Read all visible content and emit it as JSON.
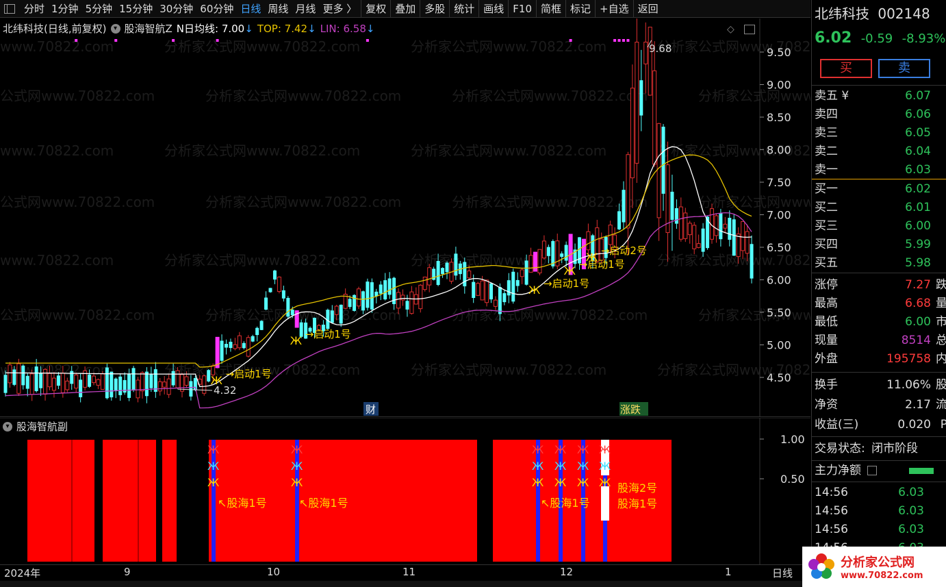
{
  "toolbar": {
    "items": [
      "分时",
      "1分钟",
      "5分钟",
      "15分钟",
      "30分钟",
      "60分钟",
      "日线",
      "周线",
      "月线",
      "更多 〉",
      "复权",
      "叠加",
      "多股",
      "统计",
      "画线",
      "F10",
      "简框",
      "标记",
      "+自选",
      "返回"
    ],
    "active": "日线"
  },
  "main_chart": {
    "stock_name": "北纬科技",
    "period_label": "(日线,前复权)",
    "indicator_name": "股海智航Z",
    "n_ma_label": "N日均线: 7.00",
    "top_label": "TOP: 7.42",
    "lin_label": "LIN: 6.58",
    "high_marker": "9.68",
    "low_marker": "4.32",
    "signal_labels": [
      "→启动1号",
      "→启动1号",
      "→启动1号",
      "→启动1号",
      "→启动2号"
    ],
    "badges": {
      "cai": "财",
      "zhangdie": "涨跌"
    },
    "price_axis": [
      "9.50",
      "9.00",
      "8.50",
      "8.00",
      "7.50",
      "7.00",
      "6.50",
      "6.00",
      "5.50",
      "5.00",
      "4.50"
    ],
    "watermark": "分析家公式网www.70822.com"
  },
  "sub_chart": {
    "title": "股海智航副",
    "axis": [
      "1.00",
      "0.50"
    ],
    "labels": [
      "↖股海1号",
      "↖股海1号",
      "↖股海1号",
      "股海2号",
      "股海1号"
    ]
  },
  "date_axis": [
    "2024年",
    "9",
    "10",
    "11",
    "12",
    "1"
  ],
  "date_axis_mode": "日线",
  "chart_data": {
    "type": "candlestick",
    "title": "北纬科技 (日线,前复权)",
    "ylim": [
      4.2,
      9.85
    ],
    "high": 9.68,
    "low": 4.32,
    "lines": [
      {
        "name": "N日均线",
        "last": 7.0,
        "color": "#ffffff"
      },
      {
        "name": "TOP",
        "last": 7.42,
        "color": "#e6c200"
      },
      {
        "name": "LIN",
        "last": 6.58,
        "color": "#c040c0"
      }
    ]
  },
  "quote": {
    "name": "北纬科技",
    "code": "002148",
    "price": "6.02",
    "change": "-0.59",
    "pct": "-8.93%",
    "buy_label": "买",
    "sell_label": "卖",
    "asks": [
      {
        "label": "卖五 ¥",
        "price": "6.07"
      },
      {
        "label": "卖四",
        "price": "6.06"
      },
      {
        "label": "卖三",
        "price": "6.05"
      },
      {
        "label": "卖二",
        "price": "6.04"
      },
      {
        "label": "卖一",
        "price": "6.03"
      }
    ],
    "bids": [
      {
        "label": "买一",
        "price": "6.02"
      },
      {
        "label": "买二",
        "price": "6.01"
      },
      {
        "label": "买三",
        "price": "6.00"
      },
      {
        "label": "买四",
        "price": "5.99"
      },
      {
        "label": "买五",
        "price": "5.98"
      }
    ],
    "stats": [
      {
        "label": "涨停",
        "value": "7.27",
        "cls": "red",
        "tail": "跌"
      },
      {
        "label": "最高",
        "value": "6.68",
        "cls": "red",
        "tail": "量"
      },
      {
        "label": "最低",
        "value": "6.00",
        "cls": "green",
        "tail": "市"
      },
      {
        "label": "现量",
        "value": "8514",
        "cls": "purple",
        "tail": "总"
      },
      {
        "label": "外盘",
        "value": "195758",
        "cls": "red",
        "tail": "内"
      }
    ],
    "stats2": [
      {
        "label": "换手",
        "value": "11.06%",
        "tail": "股"
      },
      {
        "label": "净资",
        "value": "2.17",
        "tail": "流"
      },
      {
        "label": "收益(三)",
        "value": "0.020",
        "tail": "P"
      }
    ],
    "status_label": "交易状态:",
    "status_value": "闭市阶段",
    "flow_label": "主力净额",
    "ticks": [
      {
        "time": "14:56",
        "price": "6.03"
      },
      {
        "time": "14:56",
        "price": "6.03"
      },
      {
        "time": "14:56",
        "price": "6.03"
      },
      {
        "time": "14:56",
        "price": "6.03"
      }
    ]
  },
  "logo": {
    "line1": "分析家公式网",
    "line2": "www.70822.com"
  }
}
